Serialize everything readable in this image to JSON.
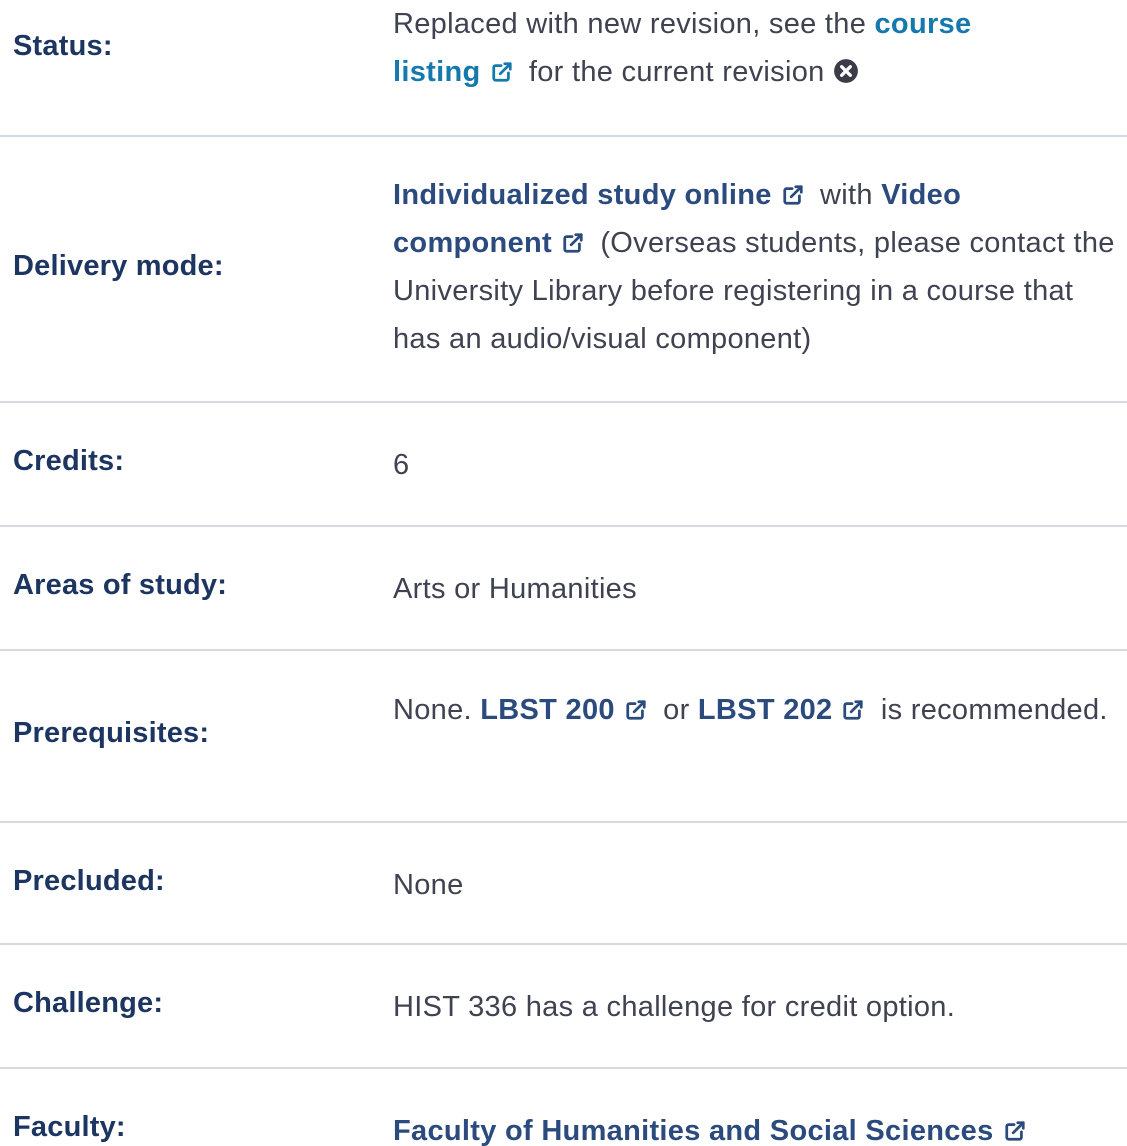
{
  "status": {
    "label": "Status:",
    "text_before": "Replaced with new revision, see the ",
    "link_text_1": "course",
    "link_text_2": "listing",
    "text_after": " for the current revision",
    "icon": "circle-x-icon"
  },
  "delivery": {
    "label": "Delivery mode:",
    "link1": "Individualized study online",
    "text_with": " with ",
    "link2_a": "Video",
    "link2_b": "component",
    "note": " (Overseas students, please contact the University Library before registering in a course that has an audio/visual component)"
  },
  "credits": {
    "label": "Credits:",
    "value": "6"
  },
  "areas": {
    "label": "Areas of study:",
    "value": "Arts or Humanities"
  },
  "prerequisites": {
    "label": "Prerequisites:",
    "text_before": "None. ",
    "link1": "LBST 200",
    "text_or": " or ",
    "link2": "LBST 202",
    "text_after": " is recommended."
  },
  "precluded": {
    "label": "Precluded:",
    "value": "None"
  },
  "challenge": {
    "label": "Challenge:",
    "value": "HIST 336 has a challenge for credit option."
  },
  "faculty": {
    "label": "Faculty:",
    "link": "Faculty of Humanities and Social Sciences"
  },
  "colors": {
    "label": "#1c3561",
    "link": "#2b4a7d",
    "link_teal": "#1679ae",
    "text": "#3f4250",
    "divider": "#d4d9e3"
  },
  "icons": {
    "external_link": "external-link-icon"
  }
}
